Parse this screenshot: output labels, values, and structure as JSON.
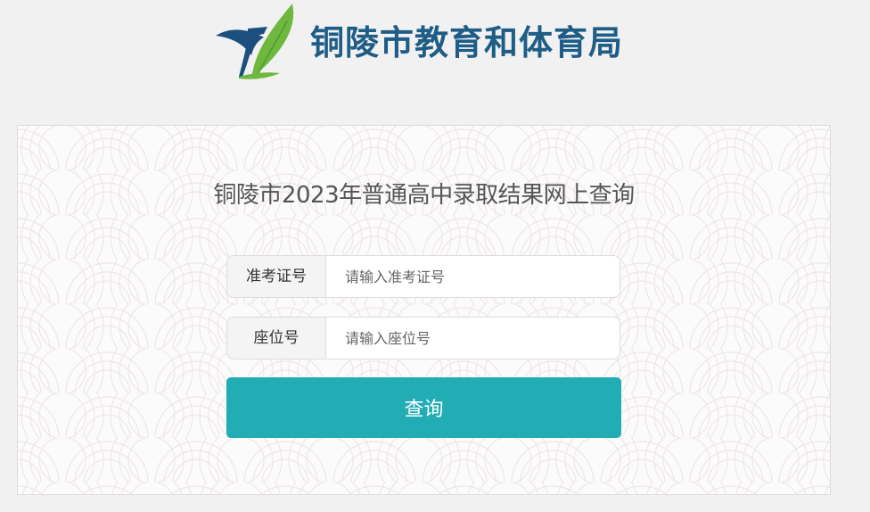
{
  "header": {
    "logo_icon": "tongling-education-logo-icon",
    "org_name": "铜陵市教育和体育局",
    "brand_color": "#1e5d86"
  },
  "query_form": {
    "title": "铜陵市2023年普通高中录取结果网上查询",
    "fields": [
      {
        "label": "准考证号",
        "placeholder": "请输入准考证号",
        "value": ""
      },
      {
        "label": "座位号",
        "placeholder": "请输入座位号",
        "value": ""
      }
    ],
    "submit_label": "查询",
    "accent_color": "#22adb4"
  }
}
